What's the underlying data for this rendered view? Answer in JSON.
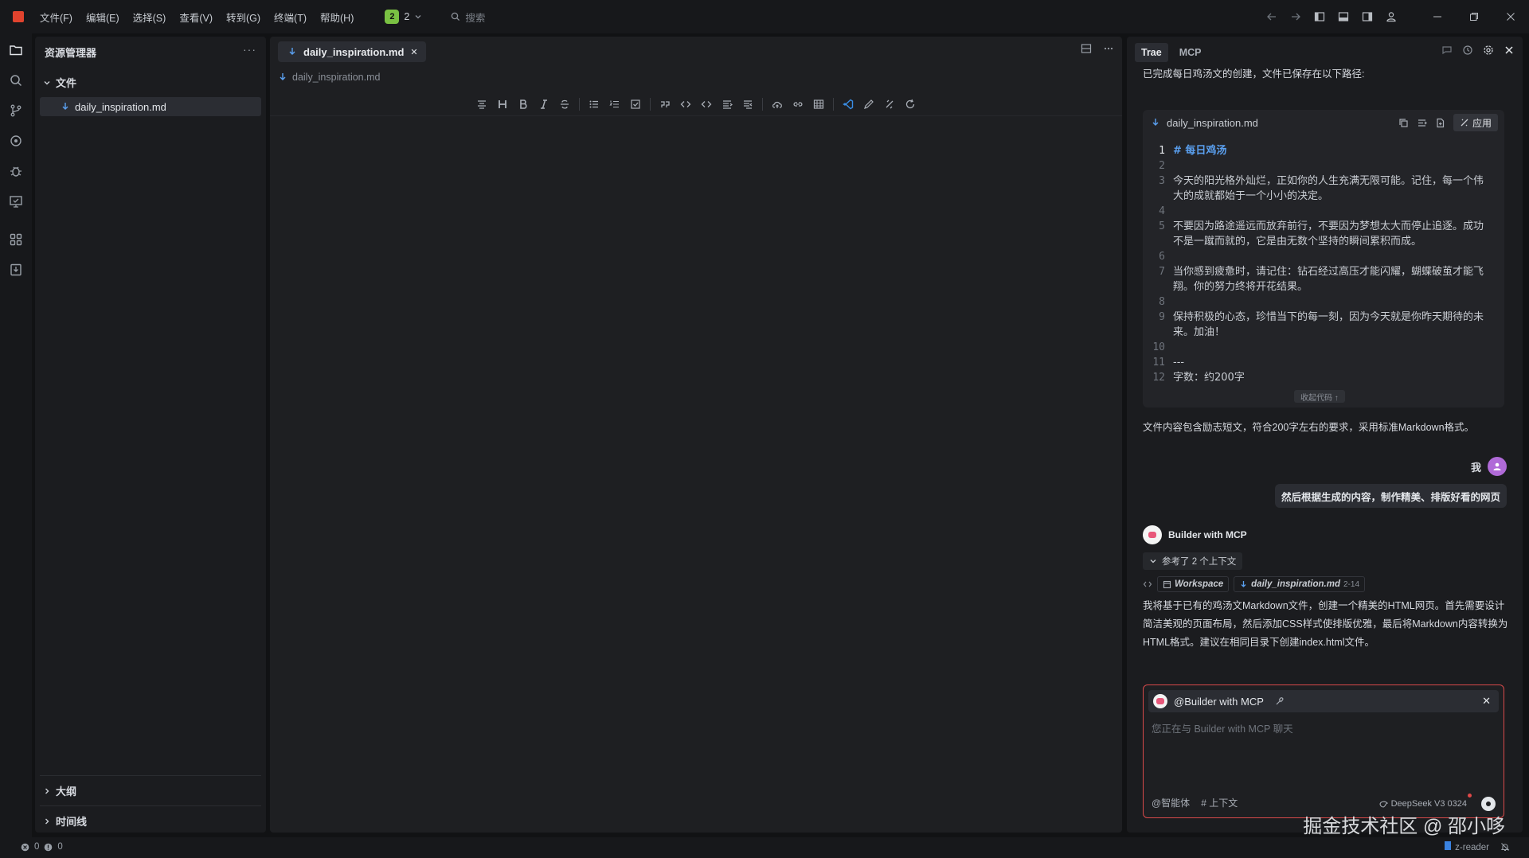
{
  "titlebar": {
    "menus": [
      "文件(F)",
      "编辑(E)",
      "选择(S)",
      "查看(V)",
      "转到(G)",
      "终端(T)",
      "帮助(H)"
    ],
    "badge_count": "2",
    "badge_label": "2",
    "search_placeholder": "搜索"
  },
  "explorer": {
    "title": "资源管理器",
    "more": "···",
    "section_files": "文件",
    "file_name": "daily_inspiration.md",
    "section_outline": "大纲",
    "section_timeline": "时间线"
  },
  "editor": {
    "tab_label": "daily_inspiration.md",
    "tab_close": "✕",
    "breadcrumb": "daily_inspiration.md"
  },
  "chat": {
    "tabs": [
      "Trae",
      "MCP"
    ],
    "intro": "已完成每日鸡汤文的创建，文件已保存在以下路径:",
    "code_file": "daily_inspiration.md",
    "apply_label": "应用",
    "code_lines": [
      {
        "n": "1",
        "t": "# 每日鸡汤"
      },
      {
        "n": "2",
        "t": ""
      },
      {
        "n": "3",
        "t": "今天的阳光格外灿烂，正如你的人生充满无限可能。记住，每一个伟大的成就都始于一个小小的决定。"
      },
      {
        "n": "4",
        "t": ""
      },
      {
        "n": "5",
        "t": "不要因为路途遥远而放弃前行，不要因为梦想太大而停止追逐。成功不是一蹴而就的，它是由无数个坚持的瞬间累积而成。"
      },
      {
        "n": "6",
        "t": ""
      },
      {
        "n": "7",
        "t": "当你感到疲惫时，请记住：钻石经过高压才能闪耀，蝴蝶破茧才能飞翔。你的努力终将开花结果。"
      },
      {
        "n": "8",
        "t": ""
      },
      {
        "n": "9",
        "t": "保持积极的心态，珍惜当下的每一刻，因为今天就是你昨天期待的未来。加油！"
      },
      {
        "n": "10",
        "t": ""
      },
      {
        "n": "11",
        "t": "---"
      },
      {
        "n": "12",
        "t": "字数：约200字"
      }
    ],
    "collapse_label": "收起代码 ↑",
    "summary": "文件内容包含励志短文，符合200字左右的要求，采用标准Markdown格式。",
    "me_label": "我",
    "user_message": "然后根据生成的内容，制作精美、排版好看的网页",
    "bot_name": "Builder with MCP",
    "context_label": "参考了 2 个上下文",
    "ctx_workspace": "Workspace",
    "ctx_file": "daily_inspiration.md",
    "ctx_range": "2-14",
    "bot_reply": "我将基于已有的鸡汤文Markdown文件，创建一个精美的HTML网页。首先需要设计简洁美观的页面布局，然后添加CSS样式使排版优雅，最后将Markdown内容转换为HTML格式。建议在相同目录下创建index.html文件。",
    "mention": "@Builder with MCP",
    "input_placeholder": "您正在与 Builder with MCP 聊天",
    "agent_label": "@智能体",
    "context_btn": "# 上下文",
    "model": "DeepSeek V3 0324"
  },
  "watermark": "掘金技术社区 @ 邵小哆",
  "status": {
    "errors": "0",
    "warnings": "0",
    "right_label": "z-reader"
  }
}
